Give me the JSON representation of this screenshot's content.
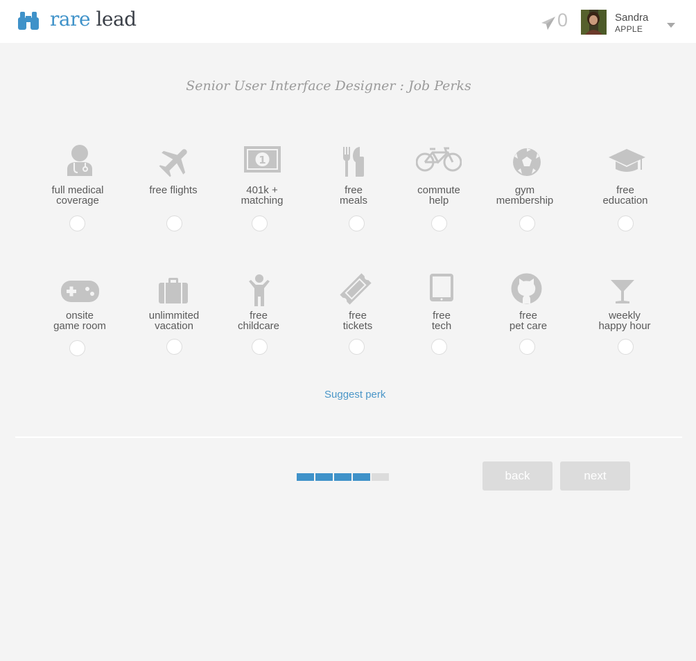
{
  "header": {
    "logo_word1": "rare",
    "logo_word2": "lead",
    "sent_count": "0",
    "user_name": "Sandra",
    "user_company": "APPLE"
  },
  "page": {
    "title": "Senior User Interface Designer : Job Perks"
  },
  "perks_row1": [
    {
      "line1": "full medical",
      "line2": "coverage",
      "icon": "doctor-icon"
    },
    {
      "line1": "free flights",
      "line2": "",
      "icon": "airplane-icon"
    },
    {
      "line1": "401k +",
      "line2": "matching",
      "icon": "money-icon"
    },
    {
      "line1": "free",
      "line2": "meals",
      "icon": "cutlery-icon"
    },
    {
      "line1": "commute",
      "line2": "help",
      "icon": "bicycle-icon"
    },
    {
      "line1": "gym",
      "line2": "membership",
      "icon": "soccer-ball-icon"
    },
    {
      "line1": "free",
      "line2": "education",
      "icon": "graduation-cap-icon"
    }
  ],
  "perks_row2": [
    {
      "line1": "onsite",
      "line2": "game room",
      "icon": "gamepad-icon"
    },
    {
      "line1": "unlimmited",
      "line2": "vacation",
      "icon": "suitcase-icon"
    },
    {
      "line1": "free",
      "line2": "childcare",
      "icon": "child-icon"
    },
    {
      "line1": "free",
      "line2": "tickets",
      "icon": "ticket-icon"
    },
    {
      "line1": "free",
      "line2": "tech",
      "icon": "tablet-icon"
    },
    {
      "line1": "free",
      "line2": "pet care",
      "icon": "github-cat-icon"
    },
    {
      "line1": "weekly",
      "line2": "happy hour",
      "icon": "cocktail-icon"
    }
  ],
  "suggest_label": "Suggest perk",
  "progress": {
    "completed_steps": 4,
    "total_steps": 5
  },
  "buttons": {
    "back": "back",
    "next": "next"
  },
  "colors": {
    "accent": "#3f92c9",
    "icon_gray": "#c4c4c4",
    "button_gray": "#dcdcdc",
    "progress_empty": "#dcdcdc"
  }
}
